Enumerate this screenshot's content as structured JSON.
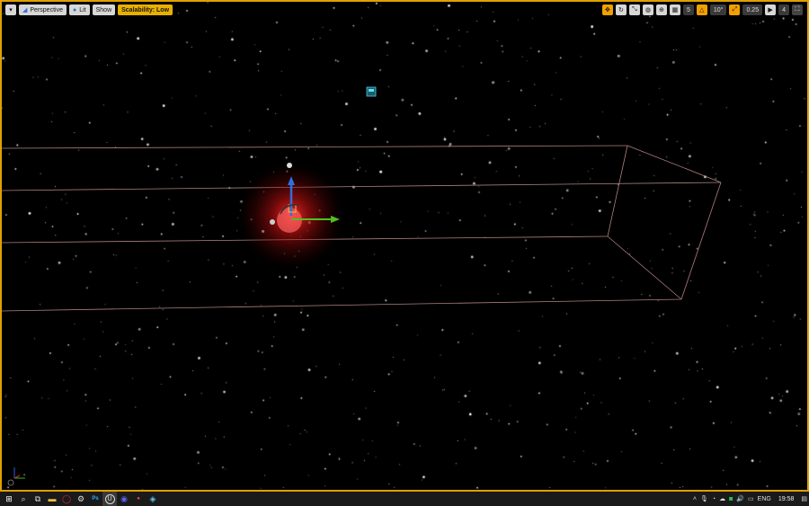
{
  "toolbar": {
    "menu_icon": "chevron-down-icon",
    "perspective_label": "Perspective",
    "lit_label": "Lit",
    "show_label": "Show",
    "scalability_label": "Scalability: Low",
    "right": {
      "grid_snap_value": "5",
      "rotation_snap_value": "10°",
      "scale_snap_value": "0.25",
      "camera_speed_value": "4"
    }
  },
  "taskbar": {
    "icons": [
      "windows-start-icon",
      "search-icon",
      "task-view-icon",
      "file-explorer-icon",
      "opera-icon",
      "settings-icon",
      "photoshop-icon",
      "unreal-engine-icon",
      "discord-icon",
      "obs-icon",
      "steam-icon"
    ],
    "photoshop_label": "Ps",
    "unreal_label": "U",
    "language": "ENG",
    "time": "19:58"
  },
  "colors": {
    "viewport_border": "#e0a000",
    "scalability_bg": "#e8b000",
    "gizmo_up": "#2f6fe0",
    "gizmo_right": "#4fc020",
    "box_line": "#b08080"
  }
}
